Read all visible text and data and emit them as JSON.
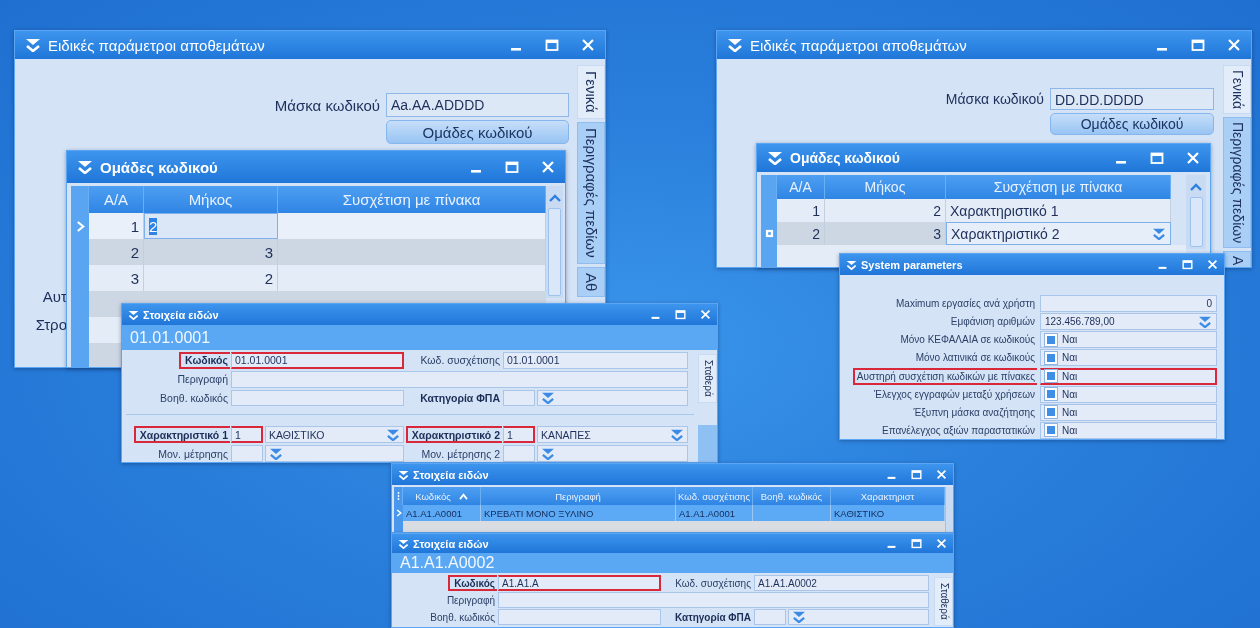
{
  "windows": [
    {
      "kind": "params",
      "title": "Ειδικές παράμετροι αποθεμάτων",
      "fields": [
        {
          "label": "Μάσκα κωδικού",
          "value": "Aa.AA.ADDDD"
        }
      ],
      "button": "Ομάδες κωδικού",
      "side_labels": [
        "Αυτ",
        "Στρο"
      ],
      "tabs": [
        {
          "label": "Γενικά",
          "selected": true
        },
        {
          "label": "Περιγραφές πεδίων",
          "selected": false
        },
        {
          "label": "Αθ",
          "selected": false
        }
      ]
    },
    {
      "kind": "groups",
      "title": "Ομάδες κωδικού",
      "columns": [
        "Α/Α",
        "Μήκος",
        "Συσχέτιση με πίνακα"
      ],
      "rows": [
        {
          "current": true,
          "editing": false,
          "cells": [
            {
              "kind": "plain",
              "text": "1"
            },
            {
              "kind": "text_edit",
              "text": "2"
            },
            {
              "kind": "plain"
            }
          ]
        },
        {
          "current": false,
          "editing": false,
          "cells": [
            {
              "kind": "plain",
              "text": "2"
            },
            {
              "kind": "plain",
              "text": "3"
            },
            {
              "kind": "plain"
            }
          ]
        },
        {
          "current": false,
          "editing": false,
          "cells": [
            {
              "kind": "plain",
              "text": "3"
            },
            {
              "kind": "plain",
              "text": "2"
            },
            {
              "kind": "plain"
            }
          ]
        }
      ]
    },
    {
      "kind": "item_form",
      "title": "Στοιχεία ειδών",
      "code": "01.01.0001",
      "tabs": [
        {
          "label": "Σταθερά",
          "selected": true
        }
      ],
      "sections": [
        {
          "rows": [
            {
              "fields": [
                {
                  "label": "Κωδικός",
                  "bold": true,
                  "highlighted": true,
                  "kind": "text",
                  "value": "01.01.0001"
                },
                {
                  "label": "Κωδ. συσχέτισης",
                  "bold": false,
                  "highlighted": false,
                  "kind": "text",
                  "value": "01.01.0001"
                }
              ]
            },
            {
              "fields": [
                {
                  "label": "Περιγραφή",
                  "bold": false,
                  "highlighted": false,
                  "kind": "wide"
                }
              ]
            },
            {
              "fields": [
                {
                  "label": "Βοηθ. κωδικός",
                  "bold": false,
                  "highlighted": false,
                  "kind": "text"
                },
                {
                  "label": "Κατηγορία ΦΠΑ",
                  "bold": true,
                  "highlighted": false,
                  "kind": "split_combo"
                }
              ]
            }
          ]
        },
        {
          "rows": [
            {
              "fields": [
                {
                  "label": "Χαρακτηριστικό 1",
                  "bold": true,
                  "highlighted": true,
                  "kind": "split_combo",
                  "value": "1",
                  "option": "ΚΑΘΙΣΤΙΚΟ"
                },
                {
                  "label": "Χαρακτηριστικό 2",
                  "bold": true,
                  "highlighted": true,
                  "kind": "split_combo",
                  "value": "1",
                  "option": "ΚΑΝΑΠΕΣ"
                }
              ]
            },
            {
              "fields": [
                {
                  "label": "Μον. μέτρησης",
                  "bold": false,
                  "highlighted": false,
                  "kind": "split_combo"
                },
                {
                  "label": "Μον. μέτρησης 2",
                  "bold": false,
                  "highlighted": false,
                  "kind": "split_combo"
                }
              ]
            }
          ]
        }
      ]
    },
    {
      "kind": "params",
      "title": "Ειδικές παράμετροι αποθεμάτων",
      "fields": [
        {
          "label": "Μάσκα κωδικού",
          "value": "DD.DD.DDDD"
        }
      ],
      "button": "Ομάδες κωδικού",
      "tabs": [
        {
          "label": "Γενικά",
          "selected": true
        },
        {
          "label": "Περιγραφές πεδίων",
          "selected": false
        },
        {
          "label": "Α",
          "selected": false
        }
      ]
    },
    {
      "kind": "groups",
      "title": "Ομάδες κωδικού",
      "columns": [
        "Α/Α",
        "Μήκος",
        "Συσχέτιση με πίνακα"
      ],
      "rows": [
        {
          "current": false,
          "editing": false,
          "cells": [
            {
              "kind": "plain",
              "text": "1"
            },
            {
              "kind": "plain",
              "text": "2"
            },
            {
              "kind": "plain",
              "text": "Χαρακτηριστικό 1"
            }
          ]
        },
        {
          "current": false,
          "editing": true,
          "cells": [
            {
              "kind": "plain",
              "text": "2"
            },
            {
              "kind": "plain",
              "text": "3"
            },
            {
              "kind": "combo_edit",
              "text": "Χαρακτηριστικό 2"
            }
          ]
        }
      ]
    },
    {
      "kind": "sys_params",
      "title": "System parameters",
      "rows": [
        {
          "label": "Maximum εργασίες ανά χρήστη",
          "kind": "number",
          "value": "0",
          "highlighted": false
        },
        {
          "label": "Εμφάνιση αριθμών",
          "kind": "dropdown",
          "value": "123.456.789,00",
          "highlighted": false
        },
        {
          "label": "Μόνο ΚΕΦΑΛΑΙΑ σε κωδικούς",
          "kind": "check",
          "checked": true,
          "value": "Ναι",
          "highlighted": false
        },
        {
          "label": "Μόνο λατινικά σε κωδικούς",
          "kind": "check",
          "checked": true,
          "value": "Ναι",
          "highlighted": false
        },
        {
          "label": "Αυστηρή συσχέτιση κωδικών με πίνακες",
          "kind": "check",
          "checked": true,
          "value": "Ναι",
          "highlighted": true
        },
        {
          "label": "Έλεγχος εγγραφών μεταξύ χρήσεων",
          "kind": "check",
          "checked": true,
          "value": "Ναι",
          "highlighted": false
        },
        {
          "label": "Έξυπνη μάσκα αναζήτησης",
          "kind": "check",
          "checked": true,
          "value": "Ναι",
          "highlighted": false
        },
        {
          "label": "Επανέλεγχος αξιών παραστατικών",
          "kind": "check",
          "checked": true,
          "value": "Ναι",
          "highlighted": false
        }
      ]
    },
    {
      "kind": "item_grid",
      "title": "Στοιχεία ειδών",
      "columns": [
        {
          "label": "Κωδικός",
          "sorted": true
        },
        {
          "label": "Περιγραφή",
          "sorted": false
        },
        {
          "label": "Κωδ. συσχέτισης",
          "sorted": false
        },
        {
          "label": "Βοηθ. κωδικός",
          "sorted": false
        },
        {
          "label": "Χαρακτηριστ",
          "sorted": false
        }
      ],
      "rows": [
        {
          "selected": true,
          "current": true,
          "cells": [
            "A1.A1.A0001",
            "ΚΡΕΒΑΤΙ ΜΟΝΟ ΞΥΛΙΝΟ",
            "A1.A1.A0001",
            null,
            "ΚΑΘΙΣΤΙΚΟ"
          ]
        }
      ]
    },
    {
      "kind": "item_form",
      "title": "Στοιχεία ειδών",
      "code": "A1.A1.A0002",
      "tabs": [
        {
          "label": "Σταθερά",
          "selected": true
        }
      ],
      "sections": [
        {
          "rows": [
            {
              "fields": [
                {
                  "label": "Κωδικός",
                  "bold": true,
                  "highlighted": true,
                  "kind": "text",
                  "value": "A1.A1.A"
                },
                {
                  "label": "Κωδ. συσχέτισης",
                  "bold": false,
                  "highlighted": false,
                  "kind": "text",
                  "value": "A1.A1.A0002"
                }
              ]
            },
            {
              "fields": [
                {
                  "label": "Περιγραφή",
                  "bold": false,
                  "highlighted": false,
                  "kind": "wide"
                }
              ]
            },
            {
              "fields": [
                {
                  "label": "Βοηθ. κωδικός",
                  "bold": false,
                  "highlighted": false,
                  "kind": "text"
                },
                {
                  "label": "Κατηγορία ΦΠΑ",
                  "bold": true,
                  "highlighted": false,
                  "kind": "split_combo"
                }
              ]
            }
          ]
        }
      ]
    }
  ]
}
